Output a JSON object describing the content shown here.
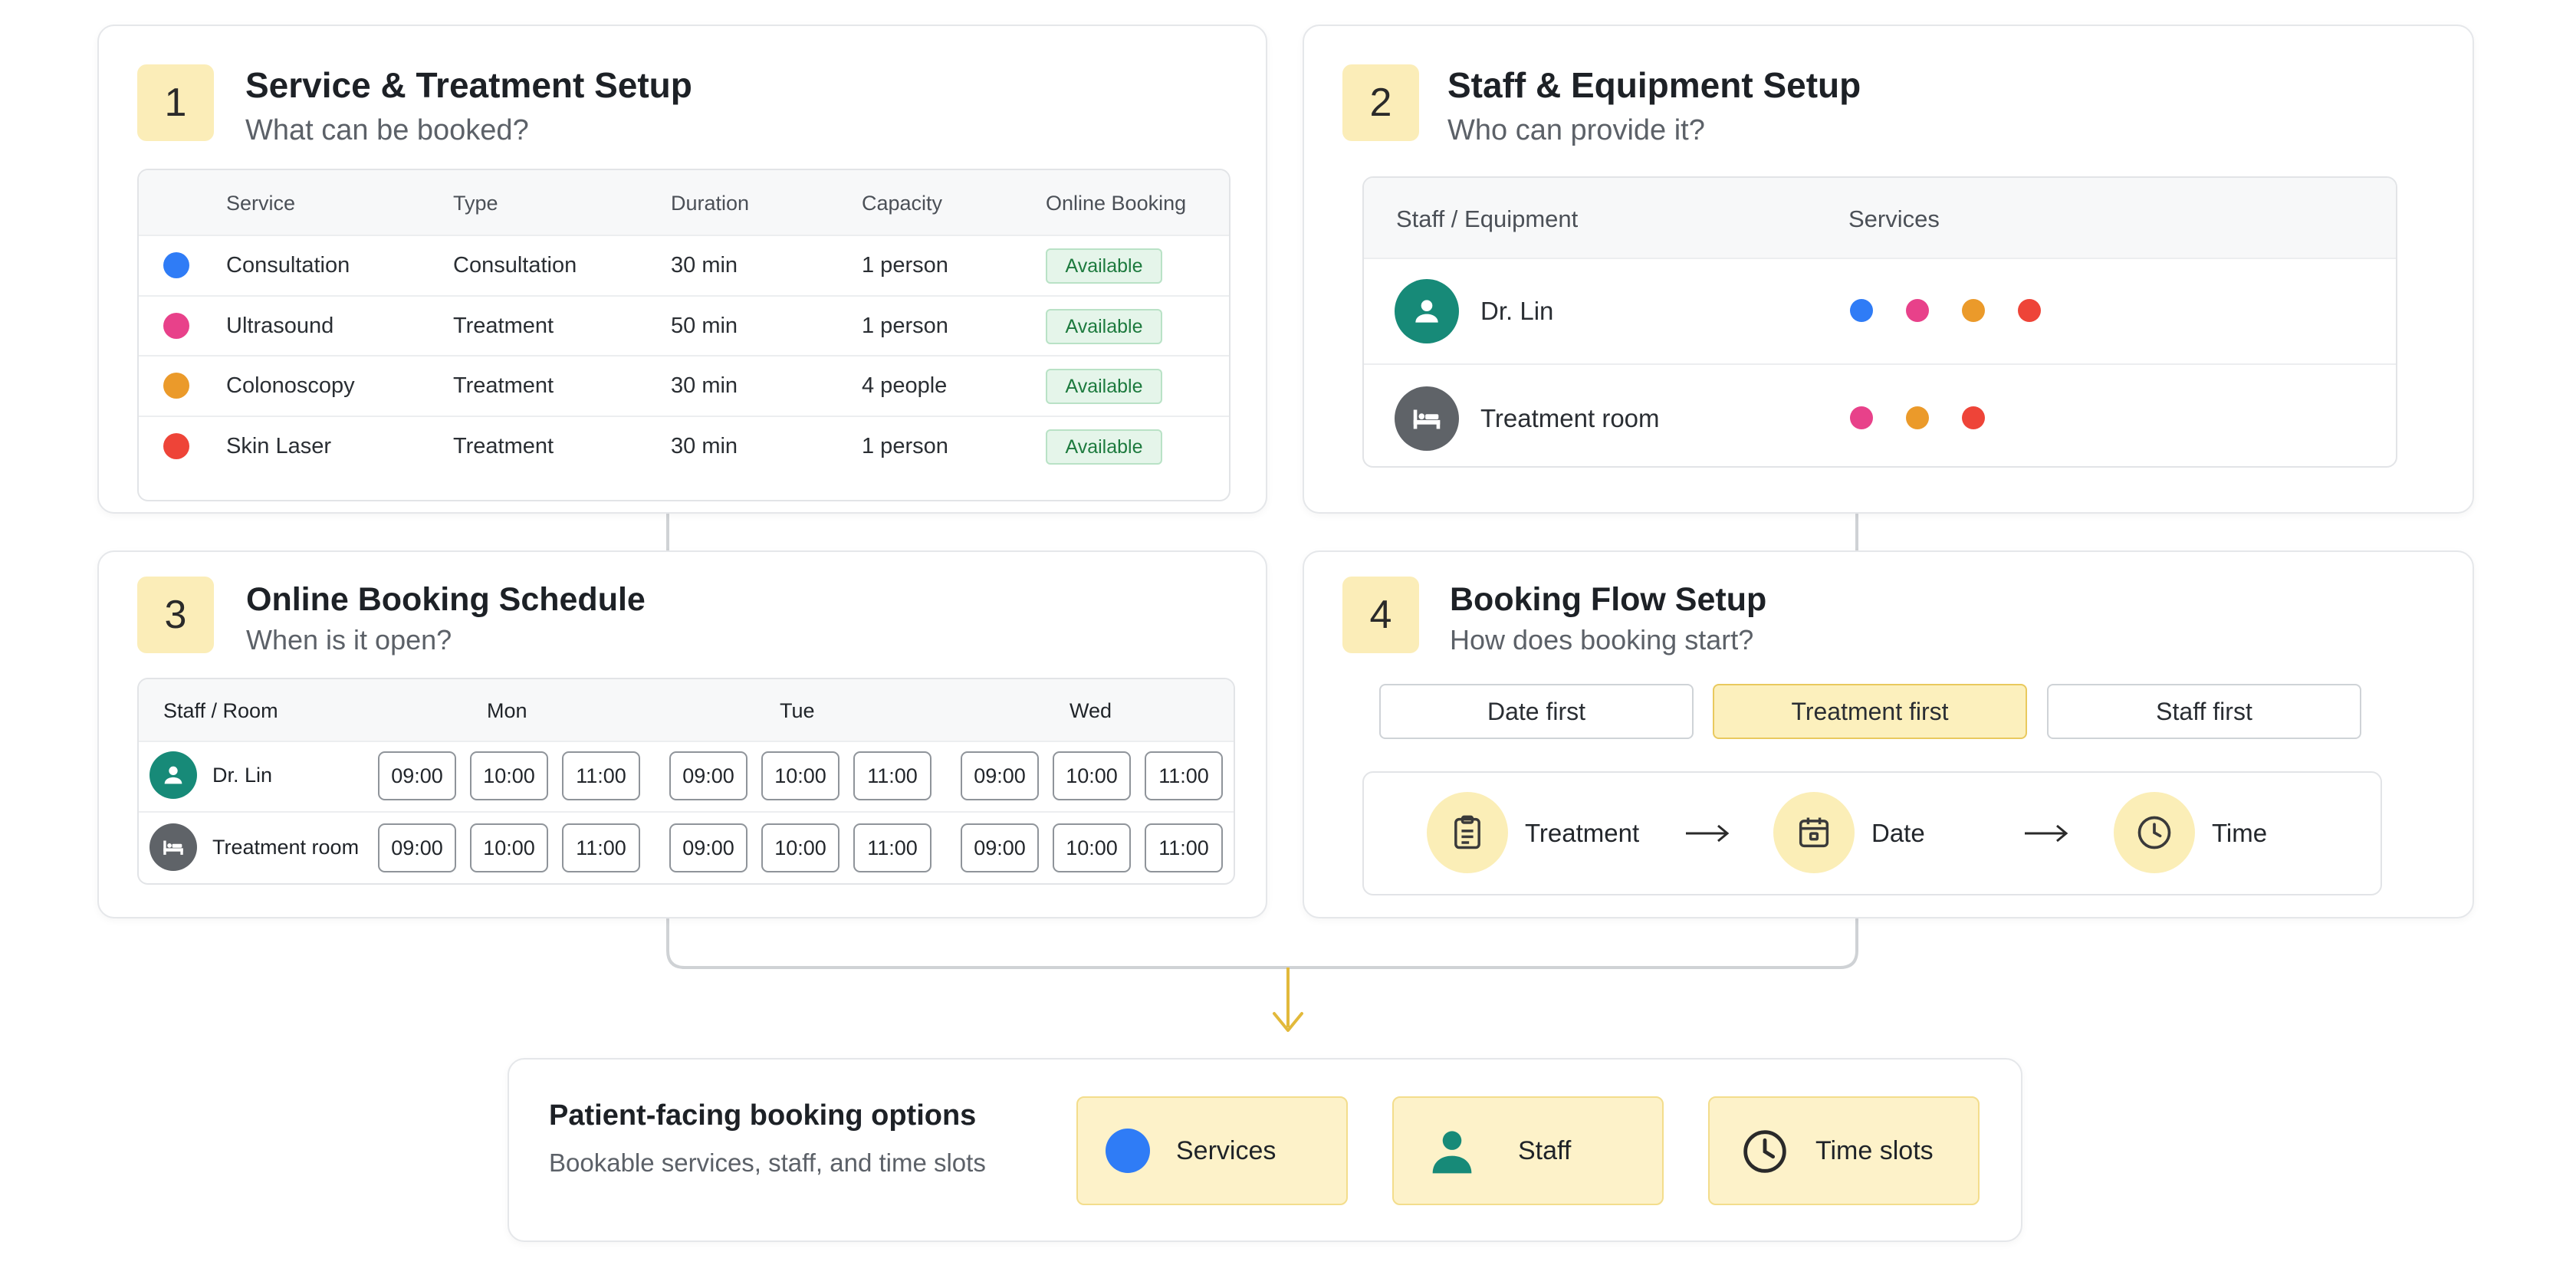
{
  "card1": {
    "number": "1",
    "title": "Service & Treatment Setup",
    "subtitle": "What can be booked?",
    "headers": [
      "Service",
      "Type",
      "Duration",
      "Capacity",
      "Online Booking"
    ],
    "rows": [
      {
        "service": "Consultation",
        "type": "Consultation",
        "duration": "30 min",
        "capacity": "1 person",
        "status": "Available",
        "color": "#2f7cf6"
      },
      {
        "service": "Ultrasound",
        "type": "Treatment",
        "duration": "50 min",
        "capacity": "1 person",
        "status": "Available",
        "color": "#e8418a"
      },
      {
        "service": "Colonoscopy",
        "type": "Treatment",
        "duration": "30 min",
        "capacity": "4 people",
        "status": "Available",
        "color": "#eb9a2a"
      },
      {
        "service": "Skin Laser",
        "type": "Treatment",
        "duration": "30 min",
        "capacity": "1 person",
        "status": "Available",
        "color": "#ee4438"
      }
    ]
  },
  "card2": {
    "number": "2",
    "title": "Staff & Equipment Setup",
    "subtitle": "Who can provide it?",
    "headers": [
      "Staff / Equipment",
      "Services"
    ],
    "rows": [
      {
        "name": "Dr. Lin",
        "icon": "person-icon",
        "service_colors": [
          "#2f7cf6",
          "#e8418a",
          "#eb9a2a",
          "#ee4438"
        ]
      },
      {
        "name": "Treatment room",
        "icon": "bed-icon",
        "service_colors": [
          "#e8418a",
          "#eb9a2a",
          "#ee4438"
        ]
      }
    ]
  },
  "card3": {
    "number": "3",
    "title": "Online Booking Schedule",
    "subtitle": "When is it open?",
    "header_first": "Staff / Room",
    "days": [
      "Mon",
      "Tue",
      "Wed"
    ],
    "rows": [
      {
        "name": "Dr. Lin",
        "icon": "person-icon",
        "slots": [
          [
            "09:00",
            "10:00",
            "11:00"
          ],
          [
            "09:00",
            "10:00",
            "11:00"
          ],
          [
            "09:00",
            "10:00",
            "11:00"
          ]
        ]
      },
      {
        "name": "Treatment room",
        "icon": "bed-icon",
        "slots": [
          [
            "09:00",
            "10:00",
            "11:00"
          ],
          [
            "09:00",
            "10:00",
            "11:00"
          ],
          [
            "09:00",
            "10:00",
            "11:00"
          ]
        ]
      }
    ]
  },
  "card4": {
    "number": "4",
    "title": "Booking Flow Setup",
    "subtitle": "How does booking start?",
    "options": [
      "Date first",
      "Treatment first",
      "Staff first"
    ],
    "selected_option": "Treatment first",
    "flow_steps": [
      {
        "label": "Treatment",
        "icon": "clipboard-icon"
      },
      {
        "label": "Date",
        "icon": "calendar-icon"
      },
      {
        "label": "Time",
        "icon": "clock-icon"
      }
    ]
  },
  "result": {
    "title": "Patient-facing booking options",
    "subtitle": "Bookable services, staff, and time slots",
    "options": [
      {
        "label": "Services",
        "icon": "blue-dot-icon"
      },
      {
        "label": "Staff",
        "icon": "person-icon"
      },
      {
        "label": "Time slots",
        "icon": "clock-icon"
      }
    ]
  },
  "colors": {
    "accent_yellow": "#fbedb8",
    "teal": "#178a78",
    "gray_icon": "#5f6368",
    "connector": "#cfd2d5",
    "arrow": "#e2b93b"
  }
}
